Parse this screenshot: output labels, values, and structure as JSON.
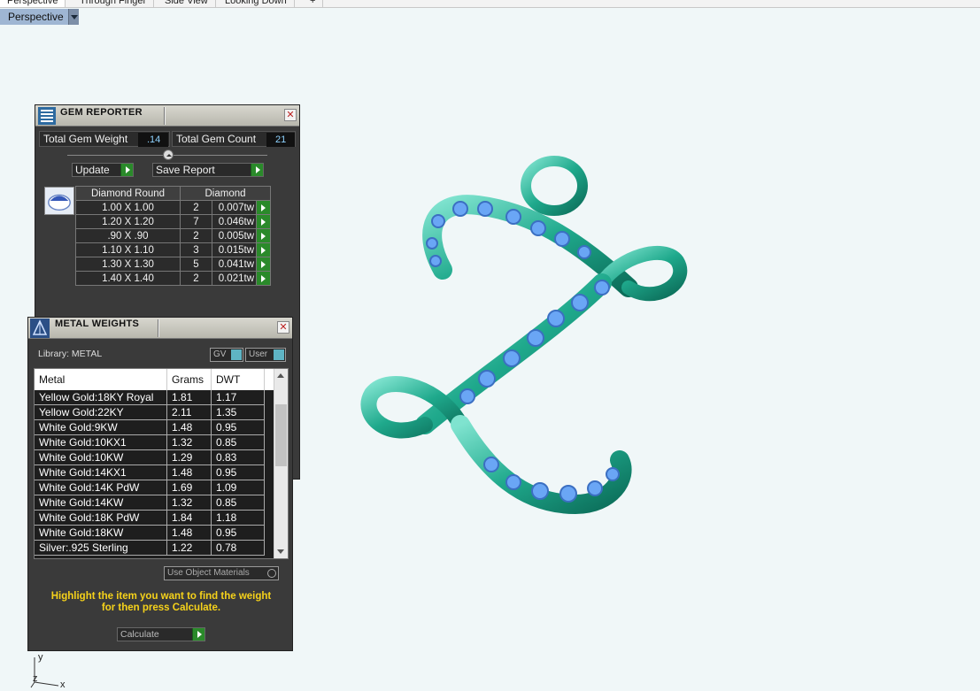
{
  "viewport_tabs": [
    "Perspective",
    "Through Finger",
    "Side View",
    "Looking Down",
    "+"
  ],
  "viewport_label": "Perspective",
  "gem_reporter": {
    "title": "GEM REPORTER",
    "total_weight_label": "Total Gem Weight",
    "total_weight_value": ".14",
    "total_count_label": "Total Gem Count",
    "total_count_value": "21",
    "update_label": "Update",
    "save_report_label": "Save Report",
    "col_shape": "Diamond Round",
    "col_material": "Diamond",
    "rows": [
      {
        "size": "1.00 X 1.00",
        "count": "2",
        "weight": "0.007tw"
      },
      {
        "size": "1.20 X 1.20",
        "count": "7",
        "weight": "0.046tw"
      },
      {
        "size": ".90 X .90",
        "count": "2",
        "weight": "0.005tw"
      },
      {
        "size": "1.10 X 1.10",
        "count": "3",
        "weight": "0.015tw"
      },
      {
        "size": "1.30 X 1.30",
        "count": "5",
        "weight": "0.041tw"
      },
      {
        "size": "1.40 X 1.40",
        "count": "2",
        "weight": "0.021tw"
      }
    ]
  },
  "metal_weights": {
    "title": "METAL WEIGHTS",
    "library_label": "Library: METAL",
    "gv_label": "GV",
    "user_label": "User",
    "col_metal": "Metal",
    "col_grams": "Grams",
    "col_dwt": "DWT",
    "rows": [
      {
        "metal": "Yellow Gold:18KY Royal",
        "grams": "1.81",
        "dwt": "1.17"
      },
      {
        "metal": "Yellow Gold:22KY",
        "grams": "2.11",
        "dwt": "1.35"
      },
      {
        "metal": "White Gold:9KW",
        "grams": "1.48",
        "dwt": "0.95"
      },
      {
        "metal": "White Gold:10KX1",
        "grams": "1.32",
        "dwt": "0.85"
      },
      {
        "metal": "White Gold:10KW",
        "grams": "1.29",
        "dwt": "0.83"
      },
      {
        "metal": "White Gold:14KX1",
        "grams": "1.48",
        "dwt": "0.95"
      },
      {
        "metal": "White Gold:14K PdW",
        "grams": "1.69",
        "dwt": "1.09"
      },
      {
        "metal": "White Gold:14KW",
        "grams": "1.32",
        "dwt": "0.85"
      },
      {
        "metal": "White Gold:18K PdW",
        "grams": "1.84",
        "dwt": "1.18"
      },
      {
        "metal": "White Gold:18KW",
        "grams": "1.48",
        "dwt": "0.95"
      },
      {
        "metal": "Silver:.925 Sterling",
        "grams": "1.22",
        "dwt": "0.78"
      }
    ],
    "use_object_materials_label": "Use Object Materials",
    "hint_line1": "Highlight the item you want to find the weight",
    "hint_line2": "for then press Calculate.",
    "calculate_label": "Calculate"
  },
  "axis": {
    "y": "y",
    "z": "z",
    "x": "x"
  },
  "colors": {
    "metal": "#1fa98c",
    "gem": "#6aa6f5",
    "viewport_bg": "#f0f7f8",
    "panel_bg": "#3a3a3a"
  }
}
